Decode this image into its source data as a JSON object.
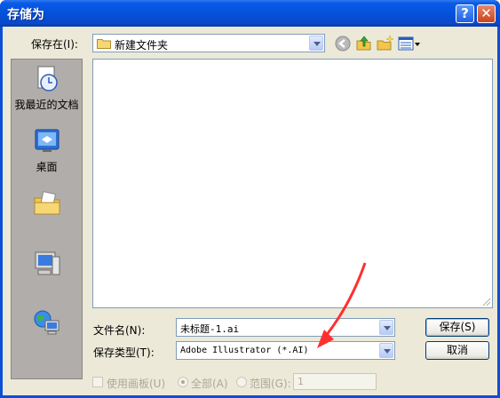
{
  "window": {
    "title": "存储为",
    "help_label": "?",
    "close_label": "✕"
  },
  "toolbar": {
    "save_in_label": "保存在(I):",
    "location": "新建文件夹",
    "icons": [
      "back-icon",
      "up-folder-icon",
      "new-folder-icon",
      "view-menu-icon"
    ]
  },
  "places": [
    {
      "name": "recent",
      "label": "我最近的文档"
    },
    {
      "name": "desktop",
      "label": "桌面"
    },
    {
      "name": "my-documents",
      "label": ""
    },
    {
      "name": "my-computer",
      "label": ""
    },
    {
      "name": "network",
      "label": ""
    }
  ],
  "form": {
    "filename_label": "文件名(N):",
    "filename_value": "未标题-1.ai",
    "filetype_label": "保存类型(T):",
    "filetype_value": "Adobe Illustrator (*.AI)",
    "save_button": "保存(S)",
    "cancel_button": "取消"
  },
  "options": {
    "artboards_label": "使用画板(U)",
    "all_label": "全部(A)",
    "range_label": "范围(G):",
    "range_value": "1"
  },
  "colors": {
    "title_bar": "#0a52dd",
    "dialog_bg": "#ece9d8",
    "places_bar": "#b0adab",
    "annotation_arrow": "#ff3030"
  }
}
